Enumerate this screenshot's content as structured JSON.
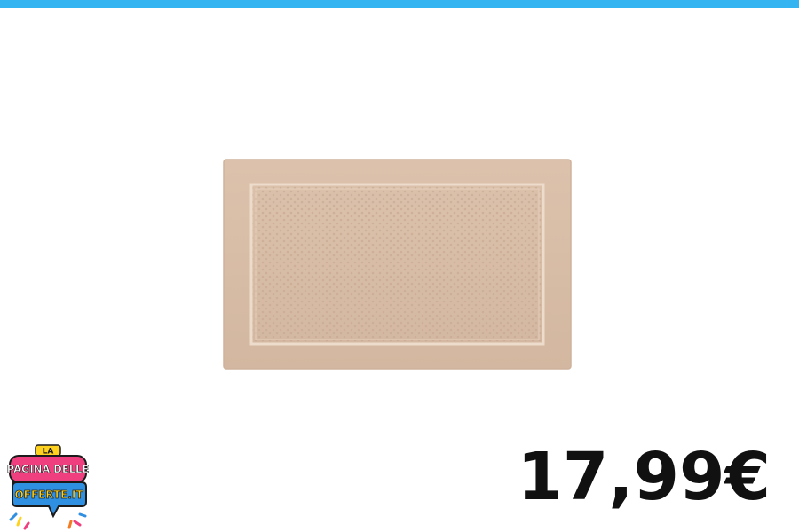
{
  "colors": {
    "top_bar": "#35b4f2",
    "towel_base": "#d9bea7",
    "towel_border_line": "#eddccc",
    "towel_dot": "#c8a891",
    "price_text": "#111111",
    "logo_pink": "#ef3f7f",
    "logo_blue": "#2f8fe0",
    "logo_yellow": "#ffd21f",
    "logo_orange": "#f47b20",
    "logo_outline": "#1b1b1b"
  },
  "product": {
    "image_name": "bath-mat"
  },
  "price": {
    "label": "17,99€"
  },
  "logo": {
    "line_la": "LA",
    "line_pagina": "PAGINA DELLE",
    "line_offerte": "OFFERTE.IT"
  }
}
